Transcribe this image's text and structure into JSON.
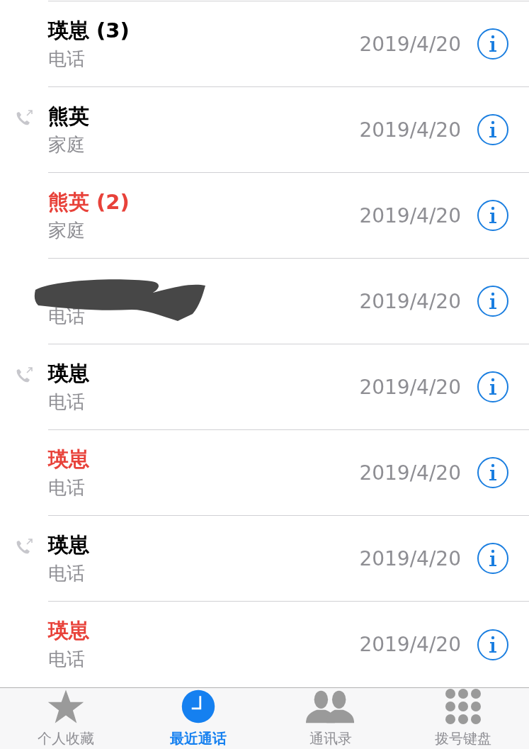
{
  "calls": [
    {
      "name": "瑛崽 (3)",
      "type": "电话",
      "date": "2019/4/20",
      "missed": false,
      "outgoing": false
    },
    {
      "name": "熊英",
      "type": "家庭",
      "date": "2019/4/20",
      "missed": false,
      "outgoing": true
    },
    {
      "name": "熊英 (2)",
      "type": "家庭",
      "date": "2019/4/20",
      "missed": true,
      "outgoing": false
    },
    {
      "redacted": true,
      "type": "电话",
      "date": "2019/4/20",
      "missed": false,
      "outgoing": false
    },
    {
      "name": "瑛崽",
      "type": "电话",
      "date": "2019/4/20",
      "missed": false,
      "outgoing": true
    },
    {
      "name": "瑛崽",
      "type": "电话",
      "date": "2019/4/20",
      "missed": true,
      "outgoing": false
    },
    {
      "name": "瑛崽",
      "type": "电话",
      "date": "2019/4/20",
      "missed": false,
      "outgoing": true
    },
    {
      "name": "瑛崽",
      "type": "电话",
      "date": "2019/4/20",
      "missed": true,
      "outgoing": false
    }
  ],
  "tab_bar": [
    {
      "label": "个人收藏",
      "kind": "star",
      "selected": false
    },
    {
      "label": "最近通话",
      "kind": "clock",
      "selected": true
    },
    {
      "label": "通讯录",
      "kind": "contacts",
      "selected": false
    },
    {
      "label": "拨号键盘",
      "kind": "keypad",
      "selected": false
    }
  ]
}
